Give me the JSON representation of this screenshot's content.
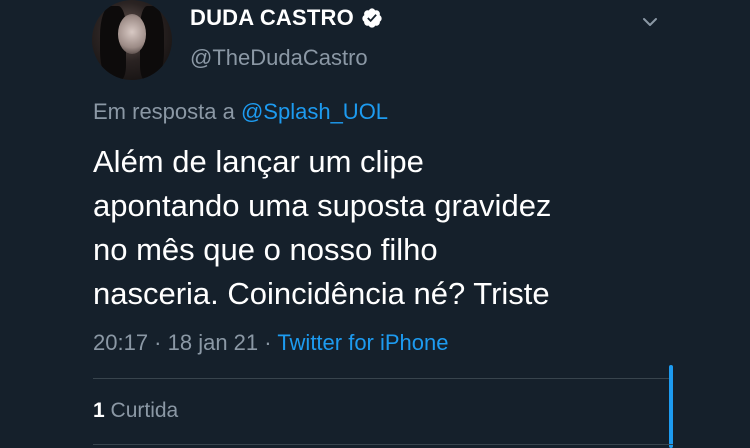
{
  "author": {
    "display_name": "DUDA CASTRO",
    "handle": "@TheDudaCastro",
    "verified": true,
    "avatar_icon": "profile-photo"
  },
  "reply": {
    "prefix": "Em resposta a",
    "mention": "@Splash_UOL"
  },
  "tweet": {
    "text": "Além de lançar um clipe\napontando uma suposta gravidez\nno mês que o nosso filho\nnasceria. Coincidência né? Triste"
  },
  "meta": {
    "time": "20:17",
    "separator1": " · ",
    "date": "18 jan 21",
    "separator2": " · ",
    "source": "Twitter for iPhone"
  },
  "stats": {
    "likes_count": "1",
    "likes_label": "Curtida"
  },
  "colors": {
    "background": "#15202b",
    "accent": "#1d9bf0",
    "secondary_text": "#8b98a5",
    "divider": "#38444d"
  }
}
